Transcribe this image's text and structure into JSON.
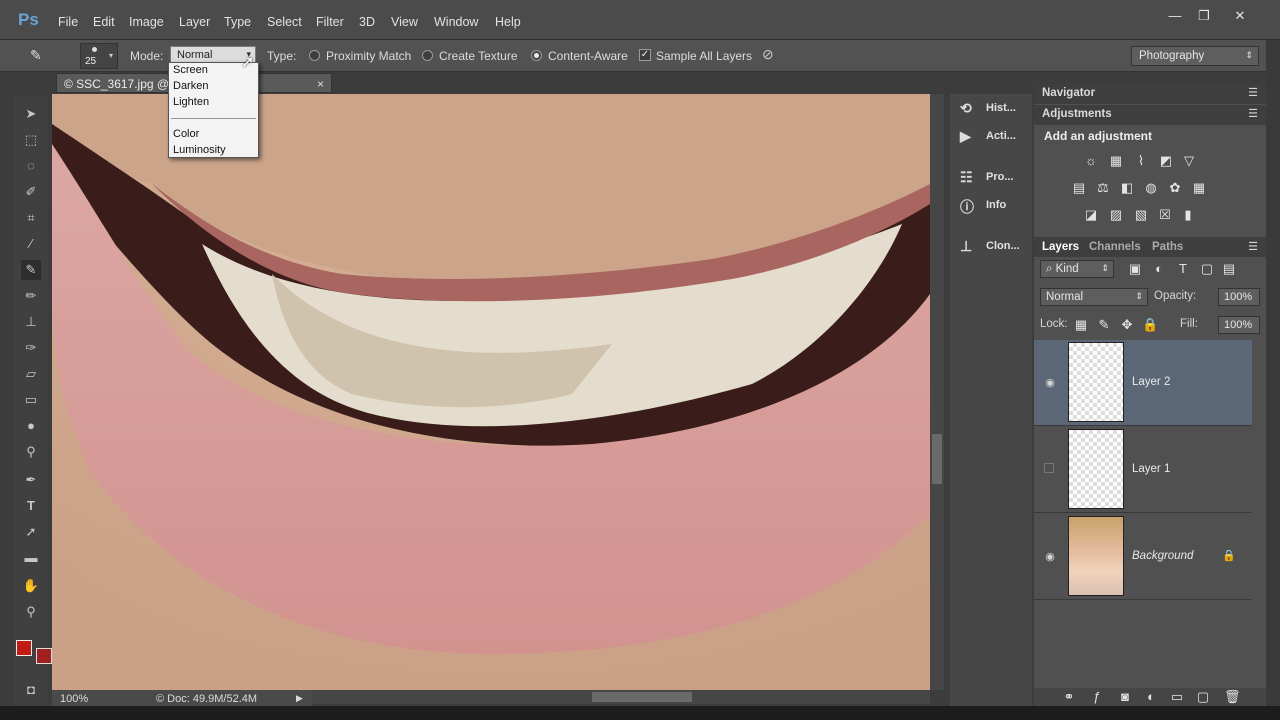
{
  "app": {
    "logo": "Ps"
  },
  "menu": [
    "File",
    "Edit",
    "Image",
    "Layer",
    "Type",
    "Select",
    "Filter",
    "3D",
    "View",
    "Window",
    "Help"
  ],
  "window_controls": {
    "minimize": "—",
    "restore": "❐",
    "close": "✕"
  },
  "options_bar": {
    "brush_size": "25",
    "mode_label": "Mode:",
    "mode_value": "Normal",
    "type_label": "Type:",
    "proximity_match": "Proximity Match",
    "create_texture": "Create Texture",
    "content_aware": "Content-Aware",
    "sample_all_layers": "Sample All Layers",
    "workspace": "Photography"
  },
  "mode_dropdown": {
    "items": [
      "Screen",
      "Darken",
      "Lighten",
      "Color",
      "Luminosity"
    ]
  },
  "document_tab": {
    "title": "© SSC_3617.jpg @ ...RGB/8*) *",
    "close": "×"
  },
  "status_bar": {
    "zoom": "100%",
    "doc": "© Doc: 49.9M/52.4M"
  },
  "collapsed_panels": [
    "Hist...",
    "Acti...",
    "Pro...",
    "Info",
    "Clon..."
  ],
  "panels": {
    "navigator": "Navigator",
    "adjustments": "Adjustments",
    "add_adjustment": "Add an adjustment",
    "layers_tabs": [
      "Layers",
      "Channels",
      "Paths"
    ],
    "kind": "Kind",
    "blend_mode": "Normal",
    "opacity_label": "Opacity:",
    "opacity_value": "100%",
    "lock_label": "Lock:",
    "fill_label": "Fill:",
    "fill_value": "100%",
    "layers": [
      {
        "name": "Layer 2",
        "visible": true,
        "selected": true
      },
      {
        "name": "Layer 1",
        "visible": false,
        "selected": false
      },
      {
        "name": "Background",
        "visible": true,
        "selected": false,
        "locked": true
      }
    ]
  },
  "colors": {
    "foreground": "#c01c14",
    "background": "#a02020",
    "selected_layer": "#5b6676"
  }
}
